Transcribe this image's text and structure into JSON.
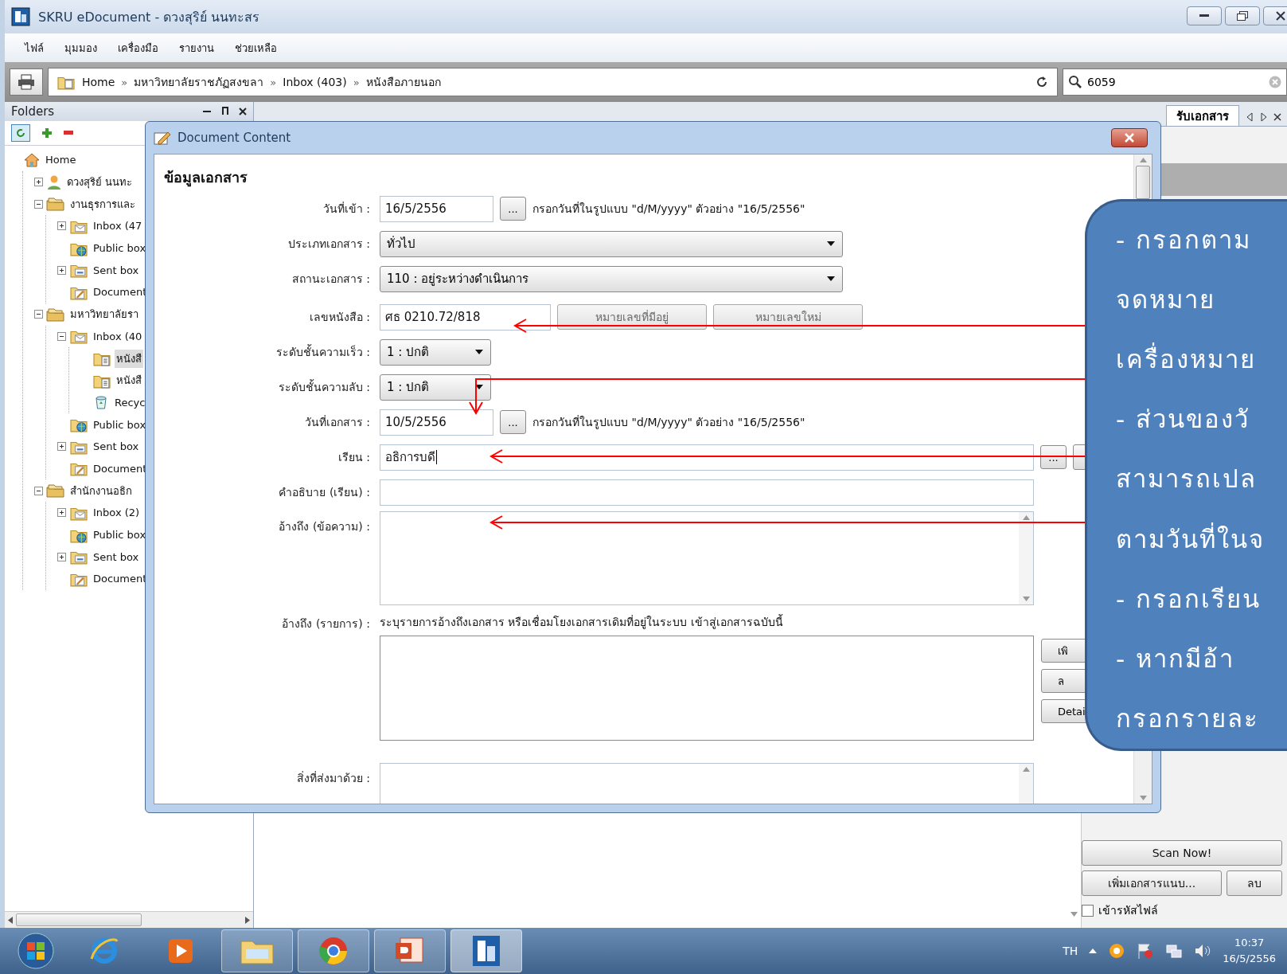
{
  "window": {
    "title": "SKRU eDocument - ดวงสุริย์ นนทะสร"
  },
  "menu": [
    "ไฟล์",
    "มุมมอง",
    "เครื่องมือ",
    "รายงาน",
    "ช่วยเหลือ"
  ],
  "breadcrumbs": [
    {
      "label": "Home"
    },
    {
      "separator": "»",
      "label": "มหาวิทยาลัยราชภัฏสงขลา"
    },
    {
      "separator": "»",
      "label": "Inbox (403)"
    },
    {
      "separator": "»",
      "label": "หนังสือภายนอก"
    }
  ],
  "search": {
    "value": "6059"
  },
  "folders": {
    "title": "Folders",
    "tree": [
      {
        "label": "Home",
        "kind": "home",
        "selected": false,
        "children": [
          {
            "label": "ดวงสุริย์ นนทะ",
            "kind": "user",
            "expanded": false,
            "selected": false
          },
          {
            "label": "งานธุรการและ",
            "kind": "group",
            "expanded": true,
            "selected": false,
            "children": [
              {
                "label": "Inbox (47",
                "kind": "inbox",
                "expanded": false,
                "selected": false
              },
              {
                "label": "Public box",
                "kind": "public",
                "selected": false
              },
              {
                "label": "Sent box",
                "kind": "sent",
                "expanded": false,
                "selected": false
              },
              {
                "label": "Document",
                "kind": "draft",
                "selected": false
              }
            ]
          },
          {
            "label": "มหาวิทยาลัยรา",
            "kind": "group",
            "expanded": true,
            "selected": false,
            "children": [
              {
                "label": "Inbox (40",
                "kind": "inbox",
                "expanded": true,
                "selected": false,
                "children": [
                  {
                    "label": "หนังสื",
                    "kind": "letters",
                    "selected": true
                  },
                  {
                    "label": "หนังสื",
                    "kind": "letters",
                    "selected": false
                  },
                  {
                    "label": "Recyc",
                    "kind": "recycle",
                    "selected": false
                  }
                ]
              },
              {
                "label": "Public box",
                "kind": "public",
                "selected": false
              },
              {
                "label": "Sent box",
                "kind": "sent",
                "expanded": false,
                "selected": false
              },
              {
                "label": "Document",
                "kind": "draft",
                "selected": false
              }
            ]
          },
          {
            "label": "สำนักงานอธิก",
            "kind": "group",
            "expanded": true,
            "selected": false,
            "children": [
              {
                "label": "Inbox (2)",
                "kind": "inbox",
                "expanded": false,
                "selected": false
              },
              {
                "label": "Public box",
                "kind": "public",
                "selected": false
              },
              {
                "label": "Sent box",
                "kind": "sent",
                "expanded": false,
                "selected": false
              },
              {
                "label": "Document",
                "kind": "draft",
                "selected": false
              }
            ]
          }
        ]
      }
    ]
  },
  "tabs": [
    {
      "label": "รับเอกสาร",
      "selected": true
    }
  ],
  "dialog": {
    "title": "Document Content",
    "heading": "ข้อมูลเอกสาร",
    "rows": [
      {
        "kind": "date",
        "label": "วันที่เข้า :",
        "value": "16/5/2556",
        "button": "...",
        "hint": "กรอกวันที่ในรูปแบบ \"d/M/yyyy\" ตัวอย่าง \"16/5/2556\""
      },
      {
        "kind": "combo",
        "label": "ประเภทเอกสาร :",
        "value": "ทั่วไป"
      },
      {
        "kind": "combo",
        "label": "สถานะเอกสาร :",
        "value": "110 : อยู่ระหว่างดำเนินการ"
      },
      {
        "kind": "number",
        "label": "เลขหนังสือ :",
        "value": "ศธ 0210.72/818",
        "buttons": [
          {
            "label": "หมายเลขที่มีอยู่",
            "disabled": true
          },
          {
            "label": "หมายเลขใหม่",
            "disabled": true
          }
        ]
      },
      {
        "kind": "combo_small",
        "label": "ระดับชั้นความเร็ว :",
        "value": "1 : ปกติ"
      },
      {
        "kind": "combo_small",
        "label": "ระดับชั้นความลับ :",
        "value": "1 : ปกติ"
      },
      {
        "kind": "date",
        "label": "วันที่เอกสาร :",
        "value": "10/5/2556",
        "button": "...",
        "hint": "กรอกวันที่ในรูปแบบ \"d/M/yyyy\" ตัวอย่าง \"16/5/2556\""
      },
      {
        "kind": "picker",
        "label": "เรียน :",
        "value": "อธิการบดี",
        "button": "..."
      },
      {
        "kind": "text",
        "label": "คำอธิบาย (เรียน) :"
      },
      {
        "kind": "memo",
        "label": "อ้างถึง (ข้อความ) :"
      },
      {
        "kind": "list",
        "label": "อ้างถึง (รายการ) :",
        "hint": "ระบุรายการอ้างถึงเอกสาร หรือเชื่อมโยงเอกสารเดิมที่อยู่ในระบบ เข้าสู่เอกสารฉบับนี้",
        "buttons": [
          "เพิ",
          "ล",
          "Detai"
        ]
      },
      {
        "kind": "memo_cut",
        "label": "สิ่งที่ส่งมาด้วย :"
      }
    ]
  },
  "attachments": {
    "scan_button": "Scan Now!",
    "add_button": "เพิ่มเอกสารแนบ...",
    "delete_button": "ลบ",
    "encrypt": {
      "label": "เข้ารหัสไฟล์",
      "checked": false
    }
  },
  "callout": {
    "lines": [
      "- กรอกตาม",
      "จดหมาย",
      "เครื่องหมาย",
      "- ส่วนของวั",
      "สามารถเปล",
      "ตามวันที่ในจ",
      "- กรอกเรียน",
      "- หากมีอ้า",
      "กรอกรายละ"
    ]
  },
  "taskbar": {
    "language": "TH",
    "time": "10:37",
    "date": "16/5/2556"
  }
}
